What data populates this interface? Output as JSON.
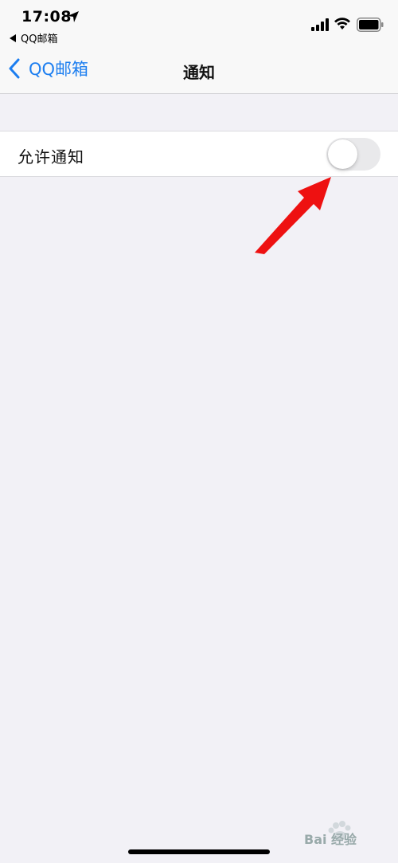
{
  "status_bar": {
    "time": "17:08",
    "back_app_label": "QQ邮箱",
    "icons": [
      "location-icon",
      "signal-icon",
      "wifi-icon",
      "battery-icon"
    ]
  },
  "nav": {
    "back_label": "QQ邮箱",
    "title": "通知"
  },
  "settings": {
    "allow_notifications": {
      "label": "允许通知",
      "enabled": false
    }
  },
  "annotation": {
    "arrow_color": "#ee1111"
  },
  "watermark": {
    "text": "Bai 经验"
  },
  "colors": {
    "accent": "#1c7ef0",
    "background": "#f2f1f6",
    "toggle_off": "#e9e9eb"
  }
}
